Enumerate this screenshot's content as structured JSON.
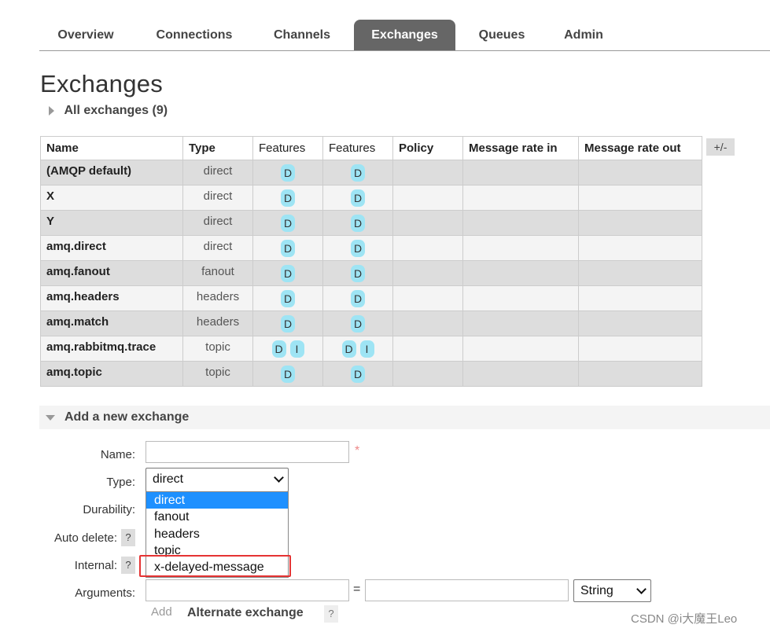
{
  "tabs": [
    {
      "label": "Overview"
    },
    {
      "label": "Connections"
    },
    {
      "label": "Channels"
    },
    {
      "label": "Exchanges"
    },
    {
      "label": "Queues"
    },
    {
      "label": "Admin"
    }
  ],
  "page_title": "Exchanges",
  "all_exchanges_label": "All exchanges (9)",
  "table": {
    "headers": [
      "Name",
      "Type",
      "Features",
      "Features",
      "Policy",
      "Message rate in",
      "Message rate out"
    ],
    "plus_minus": "+/-",
    "rows": [
      {
        "name": "(AMQP default)",
        "type": "direct",
        "f1": [
          "D"
        ],
        "f2": [
          "D"
        ]
      },
      {
        "name": "X",
        "type": "direct",
        "f1": [
          "D"
        ],
        "f2": [
          "D"
        ]
      },
      {
        "name": "Y",
        "type": "direct",
        "f1": [
          "D"
        ],
        "f2": [
          "D"
        ]
      },
      {
        "name": "amq.direct",
        "type": "direct",
        "f1": [
          "D"
        ],
        "f2": [
          "D"
        ]
      },
      {
        "name": "amq.fanout",
        "type": "fanout",
        "f1": [
          "D"
        ],
        "f2": [
          "D"
        ]
      },
      {
        "name": "amq.headers",
        "type": "headers",
        "f1": [
          "D"
        ],
        "f2": [
          "D"
        ]
      },
      {
        "name": "amq.match",
        "type": "headers",
        "f1": [
          "D"
        ],
        "f2": [
          "D"
        ]
      },
      {
        "name": "amq.rabbitmq.trace",
        "type": "topic",
        "f1": [
          "D",
          "I"
        ],
        "f2": [
          "D",
          "I"
        ]
      },
      {
        "name": "amq.topic",
        "type": "topic",
        "f1": [
          "D"
        ],
        "f2": [
          "D"
        ]
      }
    ]
  },
  "add_exchange": {
    "title": "Add a new exchange",
    "name_label": "Name:",
    "name_value": "",
    "required_mark": "*",
    "type_label": "Type:",
    "type_value": "direct",
    "type_options": [
      "direct",
      "fanout",
      "headers",
      "topic",
      "x-delayed-message"
    ],
    "durability_label": "Durability:",
    "auto_delete_label": "Auto delete:",
    "internal_label": "Internal:",
    "arguments_label": "Arguments:",
    "equals": "=",
    "arg_type_value": "String",
    "help": "?",
    "add_link": "Add",
    "alternate_exchange": "Alternate exchange"
  },
  "watermark": "CSDN @i大魔王Leo"
}
